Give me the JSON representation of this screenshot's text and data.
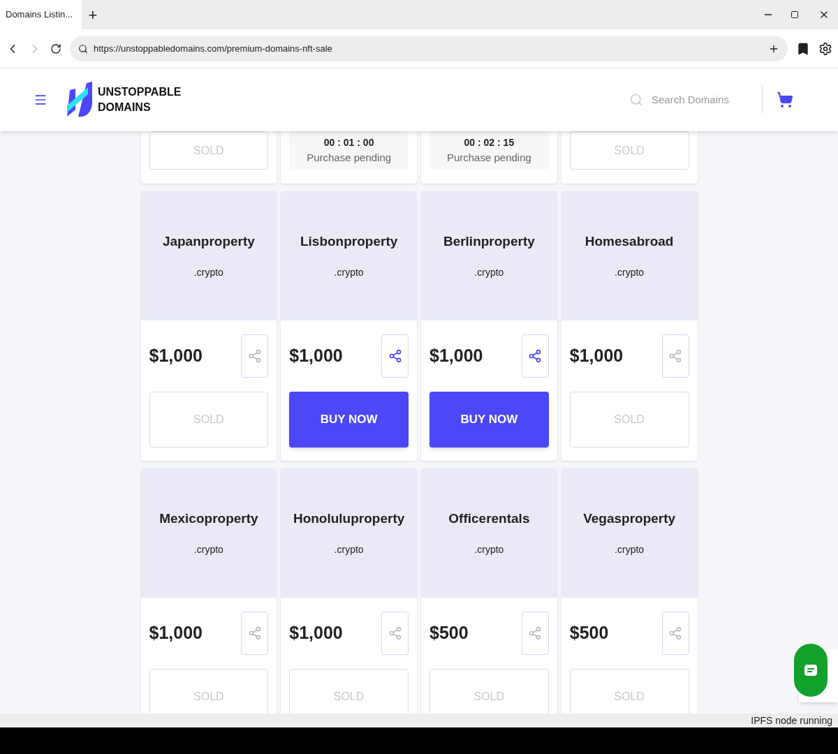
{
  "browser": {
    "tab": {
      "title": "Domains Listin...",
      "selected": true
    },
    "new_tab": "+",
    "url": "https://unstoppabledomains.com/premium-domains-nft-sale"
  },
  "header": {
    "logo": [
      "UNSTOPPABLE",
      "DOMAINS"
    ],
    "search": {
      "placeholder": "Search Domains"
    }
  },
  "top_row": [
    {
      "kind": "sold",
      "label": "SOLD"
    },
    {
      "kind": "pending",
      "timer": "00 : 01 : 00",
      "label": "Purchase pending"
    },
    {
      "kind": "pending",
      "timer": "00 : 02 : 15",
      "label": "Purchase pending"
    },
    {
      "kind": "sold",
      "label": "SOLD"
    }
  ],
  "domains": [
    {
      "name": "Japanproperty",
      "tld": ".crypto",
      "price": "$1,000",
      "available": false,
      "action": "SOLD"
    },
    {
      "name": "Lisbonproperty",
      "tld": ".crypto",
      "price": "$1,000",
      "available": true,
      "action": "BUY NOW"
    },
    {
      "name": "Berlinproperty",
      "tld": ".crypto",
      "price": "$1,000",
      "available": true,
      "action": "BUY NOW"
    },
    {
      "name": "Homesabroad",
      "tld": ".crypto",
      "price": "$1,000",
      "available": false,
      "action": "SOLD"
    },
    {
      "name": "Mexicoproperty",
      "tld": ".crypto",
      "price": "$1,000",
      "available": false,
      "action": "SOLD"
    },
    {
      "name": "Honoluluproperty",
      "tld": ".crypto",
      "price": "$1,000",
      "available": false,
      "action": "SOLD"
    },
    {
      "name": "Officerentals",
      "tld": ".crypto",
      "price": "$500",
      "available": false,
      "action": "SOLD"
    },
    {
      "name": "Vegasproperty",
      "tld": ".crypto",
      "price": "$500",
      "available": false,
      "action": "SOLD"
    }
  ],
  "status_bar": "IPFS node running"
}
